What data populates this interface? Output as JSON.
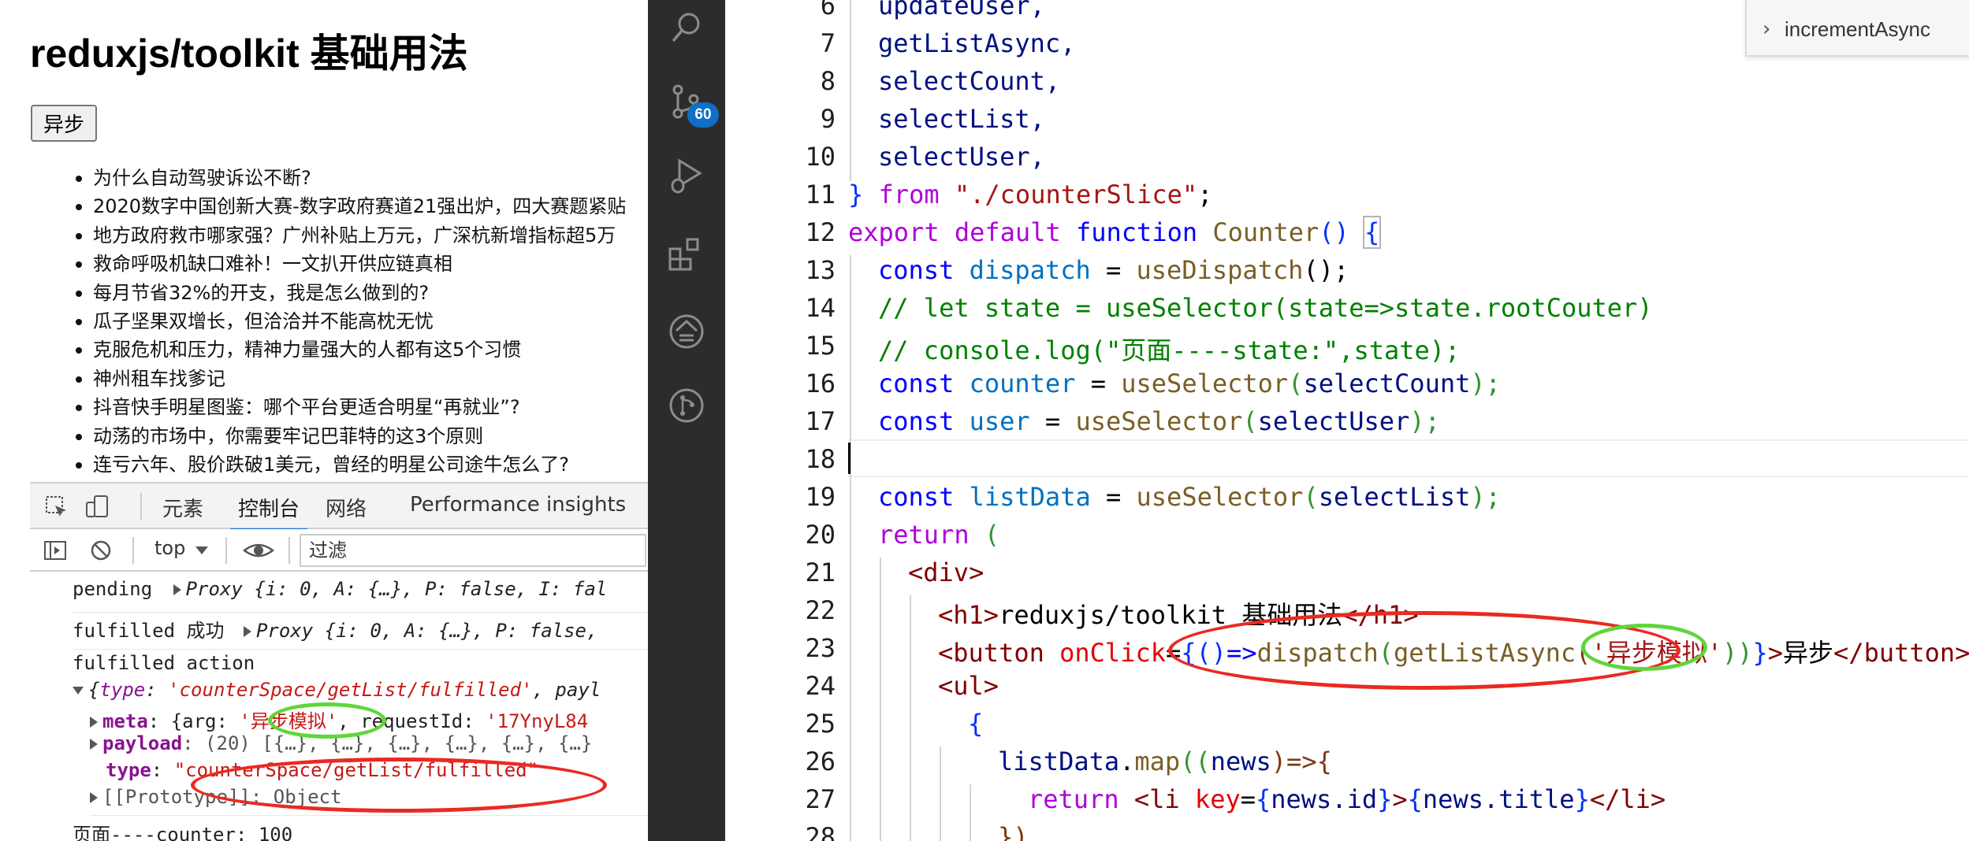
{
  "browser": {
    "heading": "reduxjs/toolkit 基础用法",
    "async_button": "异步",
    "news_items": [
      "为什么自动驾驶诉讼不断?",
      "2020数字中国创新大赛-数字政府赛道21强出炉，四大赛题紧贴",
      "地方政府救市哪家强？广州补贴上万元，广深杭新增指标超5万",
      "救命呼吸机缺口难补！一文扒开供应链真相",
      "每月节省32%的开支，我是怎么做到的?",
      "瓜子坚果双增长，但洽洽并不能高枕无忧",
      "克服危机和压力，精神力量强大的人都有这5个习惯",
      "神州租车找爹记",
      "抖音快手明星图鉴：哪个平台更适合明星“再就业”?",
      "动荡的市场中，你需要牢记巴菲特的这3个原则",
      "连亏六年、股价跌破1美元，曾经的明星公司途牛怎么了?"
    ]
  },
  "devtools": {
    "tabs": [
      "元素",
      "控制台",
      "网络",
      "Performance insights"
    ],
    "active_tab": "控制台",
    "context": "top",
    "filter_placeholder": "过滤",
    "console": {
      "l1_label": "pending",
      "l1_proxy": "Proxy",
      "l1_rest": "{i: 0, A: {…}, P: false, I: fal",
      "l2_label": "fulfilled 成功",
      "l2_proxy": "Proxy",
      "l2_rest": "{i: 0, A: {…}, P: false,",
      "l3_label": "fulfilled action",
      "l4_key": "type",
      "l4_val": "'counterSpace/getList/fulfilled'",
      "l4_tail": ", payl",
      "meta_key": "meta",
      "meta_pre": ": {arg: ",
      "meta_arg": "'异步模拟'",
      "meta_rid_key": ", requestId: ",
      "meta_rid": "'17YnyL84",
      "payload_key": "payload",
      "payload_val": ": (20) [{…}, {…}, {…}, {…}, {…}, {…}",
      "type_key": "type",
      "type_val": "\"counterSpace/getList/fulfilled\"",
      "proto": "[[Prototype]]: Object",
      "last": "页面----counter: 100"
    }
  },
  "activity_bar": {
    "icons": [
      "search-icon",
      "source-control-icon",
      "run-debug-icon",
      "extensions-icon",
      "remote-icon",
      "git-graph-icon"
    ],
    "scm_badge": "60"
  },
  "editor": {
    "breadcrumb": "incrementAsync",
    "line_numbers": [
      "6",
      "7",
      "8",
      "9",
      "10",
      "11",
      "12",
      "13",
      "14",
      "15",
      "16",
      "17",
      "18",
      "19",
      "20",
      "21",
      "22",
      "23",
      "24",
      "25",
      "26",
      "27",
      "28"
    ],
    "current_line": "18",
    "code": {
      "l6": "updateUser,",
      "l7": "getListAsync,",
      "l8": "selectCount,",
      "l9": "selectList,",
      "l10": "selectUser,",
      "l11_brace": "}",
      "l11_from": "from",
      "l11_path": "\"./counterSlice\"",
      "l11_semi": ";",
      "l12_export": "export",
      "l12_default": "default",
      "l12_function": "function",
      "l12_name": "Counter",
      "l12_parens": "()",
      "l12_brace": "{",
      "l13_const": "const",
      "l13_var": "dispatch",
      "l13_eq": " = ",
      "l13_fn": "useDispatch",
      "l13_tail": "();",
      "l14": "// let state = useSelector(state=>state.rootCouter)",
      "l15": "// console.log(\"页面----state:\",state);",
      "l16_const": "const",
      "l16_var": "counter",
      "l16_eq": " = ",
      "l16_fn": "useSelector",
      "l16_arg": "selectCount",
      "l16_tail": ");",
      "l17_const": "const",
      "l17_var": "user",
      "l17_eq": " = ",
      "l17_fn": "useSelector",
      "l17_arg": "selectUser",
      "l17_tail": ");",
      "l19_const": "const",
      "l19_var": "listData",
      "l19_eq": " = ",
      "l19_fn": "useSelector",
      "l19_arg": "selectList",
      "l19_tail": ");",
      "l20_return": "return",
      "l20_paren": "(",
      "l21_open": "<",
      "l21_tag": "div",
      "l21_close": ">",
      "l22_tag_open": "<h1>",
      "l22_text": "reduxjs/toolkit 基础用法",
      "l22_tag_close": "</h1>",
      "l23_lt": "<",
      "l23_tag": "button",
      "l23_attr": "onClick",
      "l23_eq": "=",
      "l23_b1": "{",
      "l23_p1": "()",
      "l23_arrow": "=>",
      "l23_fn1": "dispatch",
      "l23_p2": "(",
      "l23_fn2": "getListAsync",
      "l23_p3": "(",
      "l23_str": "'异步模拟'",
      "l23_p4": "))",
      "l23_b2": "}",
      "l23_gt": ">",
      "l23_text": "异步",
      "l23_end": "</button>",
      "l24_tag": "<ul>",
      "l25": "{",
      "l26_var": "listData",
      "l26_dot": ".",
      "l26_fn": "map",
      "l26_p1": "((",
      "l26_arg": "news",
      "l26_p2": ")=>",
      "l26_b": "{",
      "l27_return": "return",
      "l27_lt": "<",
      "l27_tag": "li",
      "l27_attr": "key",
      "l27_eq": "=",
      "l27_b1": "{",
      "l27_expr1": "news.id",
      "l27_b2": "}",
      "l27_gt": ">",
      "l27_b3": "{",
      "l27_expr2": "news.title",
      "l27_b4": "}",
      "l27_end": "</li>",
      "l28": "})"
    }
  },
  "colors": {
    "annotation_red": "#ea2a22",
    "annotation_green": "#5fd63a",
    "activity_bar_bg": "#2c2c2c",
    "badge_blue": "#0e6fc4"
  }
}
